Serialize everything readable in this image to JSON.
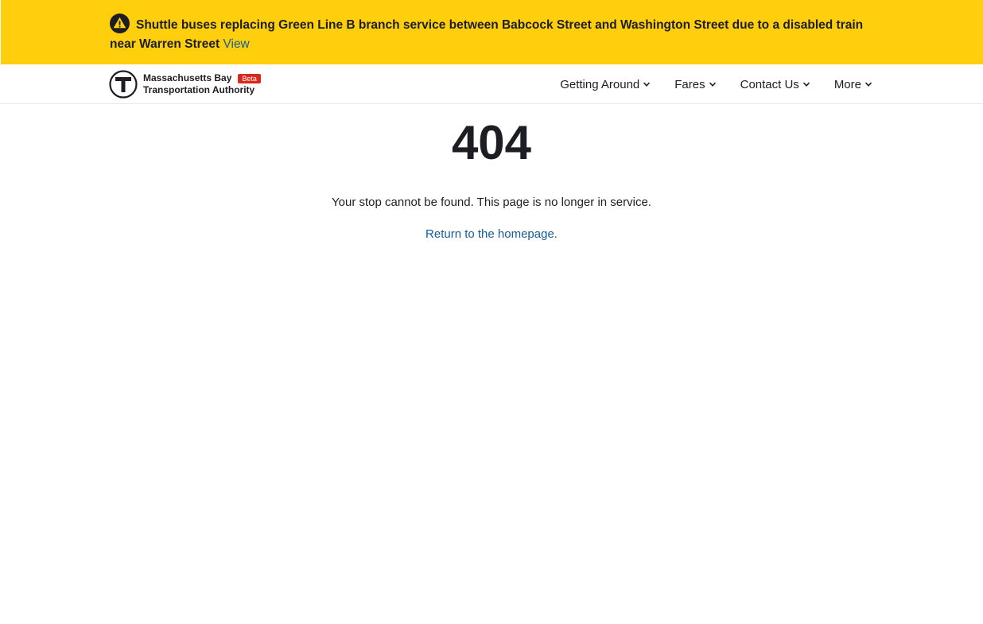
{
  "alert": {
    "icon": "alert-triangle-icon",
    "message": "Shuttle buses replacing Green Line B branch service between Babcock Street and Washington Street due to a disabled train near Warren Street",
    "link_label": "View",
    "background_color": "#ffce0c"
  },
  "header": {
    "logo": {
      "icon": "mbta-t-logo-icon",
      "line1": "Massachusetts Bay",
      "line2": "Transportation Authority",
      "badge": "Beta",
      "badge_color": "#da291c"
    },
    "nav": [
      {
        "label": "Getting Around",
        "icon": "chevron-down-icon"
      },
      {
        "label": "Fares",
        "icon": "chevron-down-icon"
      },
      {
        "label": "Contact Us",
        "icon": "chevron-down-icon"
      },
      {
        "label": "More",
        "icon": "chevron-down-icon"
      }
    ]
  },
  "main": {
    "code": "404",
    "message": "Your stop cannot be found. This page is no longer in service.",
    "home_link": "Return to the homepage.",
    "link_color": "#165c96"
  }
}
